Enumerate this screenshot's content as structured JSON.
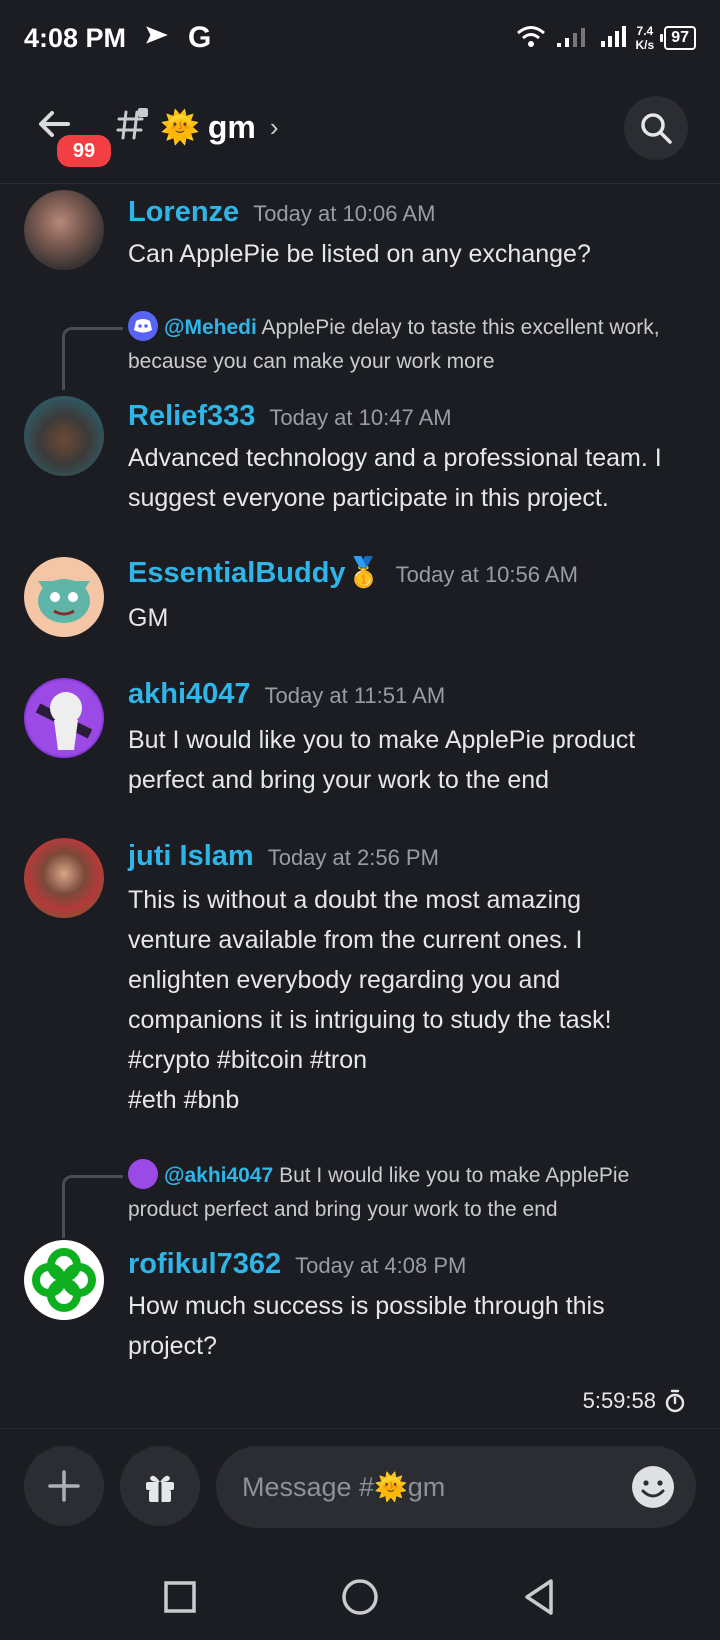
{
  "status_bar": {
    "time": "4:08 PM",
    "app_icon_letter": "G",
    "net_speed_value": "7.4",
    "net_speed_unit": "K/s",
    "battery": "97"
  },
  "header": {
    "unread_badge": "99",
    "channel_name": "gm",
    "channel_emoji": "🌞",
    "chevron": "›"
  },
  "messages": [
    {
      "author": "Lorenze",
      "time": "Today at 10:06 AM",
      "content": "Can ApplePie be listed on any exchange?"
    },
    {
      "reply_mention": "@Mehedi",
      "reply_text": "ApplePie delay to taste this excellent work, because you can make your work more",
      "author": "Relief333",
      "time": "Today at 10:47 AM",
      "content": "Advanced technology and a professional team. I suggest everyone participate in this project."
    },
    {
      "author": "EssentialBuddy",
      "author_badge": "🥇",
      "time": "Today at 10:56 AM",
      "content": "GM"
    },
    {
      "author": "akhi4047",
      "time": "Today at 11:51 AM",
      "content": "But I would like you to make ApplePie product perfect and bring your work to the end"
    },
    {
      "author": "juti Islam",
      "time": "Today at 2:56 PM",
      "content_lines": [
        "This is without a doubt the most amazing",
        "venture available from the current ones. I",
        "enlighten everybody regarding you and",
        "companions it is intriguing to study the task!",
        "#crypto #bitcoin #tron",
        "#eth #bnb"
      ]
    },
    {
      "reply_mention": "@akhi4047",
      "reply_text": "But I would like you to make ApplePie product perfect and bring your work to the end",
      "author": "rofikul7362",
      "time": "Today at 4:08 PM",
      "content": "How much success is possible through this project?"
    }
  ],
  "slowmode_timer": "5:59:58",
  "composer": {
    "placeholder_prefix": "Message #",
    "placeholder_emoji": "🌞",
    "placeholder_channel": "gm"
  },
  "colors": {
    "background": "#1c1d22",
    "author": "#2fb5e8",
    "badge": "#f23f43",
    "surface": "#2b2d33"
  },
  "icons": [
    "back-arrow-icon",
    "channel-hash-icon",
    "search-icon",
    "plus-icon",
    "gift-icon",
    "emoji-icon",
    "timer-icon",
    "recents-icon",
    "home-icon",
    "back-icon"
  ]
}
